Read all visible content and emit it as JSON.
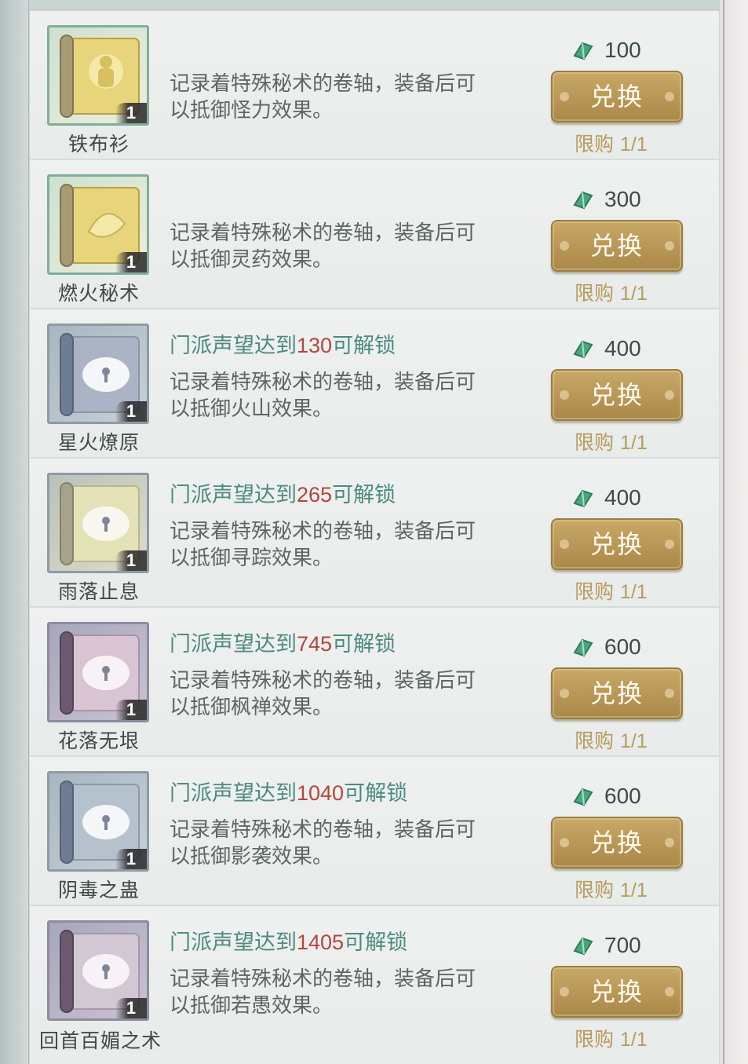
{
  "currency_icon": "green-jade-currency-icon",
  "colors": {
    "unlock_text": "#4d8a82",
    "unlock_number": "#b4453d",
    "button": "#b89656",
    "limit_text": "#b89b5e"
  },
  "items": [
    {
      "name": "铁布衫",
      "count": "1",
      "locked": false,
      "unlock_prefix": "",
      "unlock_value": "",
      "unlock_suffix": "",
      "desc_line1": "记录着特殊秘术的卷轴，装备后可",
      "desc_line2": "以抵御怪力效果。",
      "price": "100",
      "button": "兑换",
      "limit_label": "限购",
      "limit_value": "1/1"
    },
    {
      "name": "燃火秘术",
      "count": "1",
      "locked": false,
      "unlock_prefix": "",
      "unlock_value": "",
      "unlock_suffix": "",
      "desc_line1": "记录着特殊秘术的卷轴，装备后可",
      "desc_line2": "以抵御灵药效果。",
      "price": "300",
      "button": "兑换",
      "limit_label": "限购",
      "limit_value": "1/1"
    },
    {
      "name": "星火燎原",
      "count": "1",
      "locked": true,
      "unlock_prefix": "门派声望达到",
      "unlock_value": "130",
      "unlock_suffix": "可解锁",
      "desc_line1": "记录着特殊秘术的卷轴，装备后可",
      "desc_line2": "以抵御火山效果。",
      "price": "400",
      "button": "兑换",
      "limit_label": "限购",
      "limit_value": "1/1"
    },
    {
      "name": "雨落止息",
      "count": "1",
      "locked": true,
      "unlock_prefix": "门派声望达到",
      "unlock_value": "265",
      "unlock_suffix": "可解锁",
      "desc_line1": "记录着特殊秘术的卷轴，装备后可",
      "desc_line2": "以抵御寻踪效果。",
      "price": "400",
      "button": "兑换",
      "limit_label": "限购",
      "limit_value": "1/1"
    },
    {
      "name": "花落无垠",
      "count": "1",
      "locked": true,
      "unlock_prefix": "门派声望达到",
      "unlock_value": "745",
      "unlock_suffix": "可解锁",
      "desc_line1": "记录着特殊秘术的卷轴，装备后可",
      "desc_line2": "以抵御枫禅效果。",
      "price": "600",
      "button": "兑换",
      "limit_label": "限购",
      "limit_value": "1/1"
    },
    {
      "name": "阴毒之蛊",
      "count": "1",
      "locked": true,
      "unlock_prefix": "门派声望达到",
      "unlock_value": "1040",
      "unlock_suffix": "可解锁",
      "desc_line1": "记录着特殊秘术的卷轴，装备后可",
      "desc_line2": "以抵御影袭效果。",
      "price": "600",
      "button": "兑换",
      "limit_label": "限购",
      "limit_value": "1/1"
    },
    {
      "name": "回首百媚之术",
      "count": "1",
      "locked": true,
      "unlock_prefix": "门派声望达到",
      "unlock_value": "1405",
      "unlock_suffix": "可解锁",
      "desc_line1": "记录着特殊秘术的卷轴，装备后可",
      "desc_line2": "以抵御若愚效果。",
      "price": "700",
      "button": "兑换",
      "limit_label": "限购",
      "limit_value": "1/1"
    }
  ]
}
